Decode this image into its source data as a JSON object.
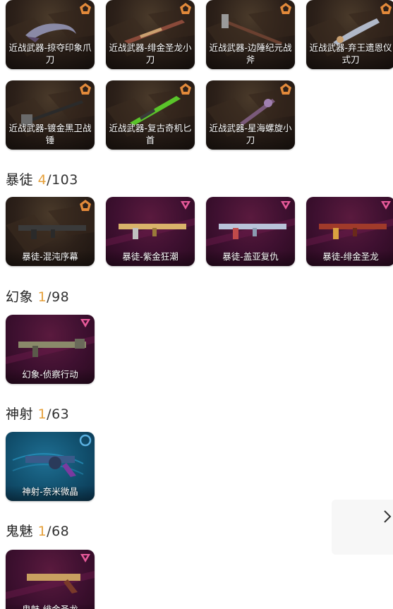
{
  "colors": {
    "owned_count": "#e6a03a",
    "gold_card": "#2c2019",
    "purple_card": "#3e1030",
    "blue_card": "#11506e"
  },
  "melee": {
    "cards": [
      {
        "label": "近战武器-掠夺印象爪刀",
        "tier": "gold",
        "weapon_icon": "claw-knife-icon",
        "badge_icon": "pentagon-tier-icon"
      },
      {
        "label": "近战武器-绯金圣龙小刀",
        "tier": "gold",
        "weapon_icon": "long-blade-icon",
        "badge_icon": "pentagon-tier-icon"
      },
      {
        "label": "近战武器-边陲纪元战斧",
        "tier": "gold",
        "weapon_icon": "axe-icon",
        "badge_icon": "pentagon-tier-icon"
      },
      {
        "label": "近战武器-弃王遗恩仪式刀",
        "tier": "gold",
        "weapon_icon": "ritual-knife-icon",
        "badge_icon": "pentagon-tier-icon"
      },
      {
        "label": "近战武器-镀金黑卫战锤",
        "tier": "gold",
        "weapon_icon": "hammer-icon",
        "badge_icon": "pentagon-tier-icon"
      },
      {
        "label": "近战武器-复古奇机匕首",
        "tier": "gold",
        "weapon_icon": "green-dagger-icon",
        "badge_icon": "pentagon-tier-icon"
      },
      {
        "label": "近战武器-星海螺旋小刀",
        "tier": "gold",
        "weapon_icon": "spiral-knife-icon",
        "badge_icon": "pentagon-tier-icon"
      }
    ]
  },
  "sections": [
    {
      "name": "暴徒",
      "owned": "4",
      "total": "103",
      "cards": [
        {
          "label": "暴徒-混沌序幕",
          "tier": "gold",
          "weapon_icon": "rifle-icon",
          "badge_icon": "pentagon-tier-icon"
        },
        {
          "label": "暴徒-紫金狂潮",
          "tier": "purple",
          "weapon_icon": "rifle-icon",
          "badge_icon": "triangle-tier-icon"
        },
        {
          "label": "暴徒-盖亚复仇",
          "tier": "purple",
          "weapon_icon": "rifle-icon",
          "badge_icon": "triangle-tier-icon"
        },
        {
          "label": "暴徒-绯金圣龙",
          "tier": "purple",
          "weapon_icon": "rifle-icon",
          "badge_icon": "triangle-tier-icon"
        }
      ]
    },
    {
      "name": "幻象",
      "owned": "1",
      "total": "98",
      "cards": [
        {
          "label": "幻象-侦察行动",
          "tier": "purple",
          "weapon_icon": "rifle-icon",
          "badge_icon": "triangle-tier-icon"
        }
      ]
    },
    {
      "name": "神射",
      "owned": "1",
      "total": "63",
      "cards": [
        {
          "label": "神射-奈米微晶",
          "tier": "blue",
          "weapon_icon": "revolver-icon",
          "badge_icon": "circle-tier-icon"
        }
      ]
    },
    {
      "name": "鬼魅",
      "owned": "1",
      "total": "68",
      "cards": [
        {
          "label": "鬼魅-绯金圣龙",
          "tier": "purple",
          "weapon_icon": "pistol-icon",
          "badge_icon": "triangle-tier-icon"
        }
      ]
    }
  ]
}
